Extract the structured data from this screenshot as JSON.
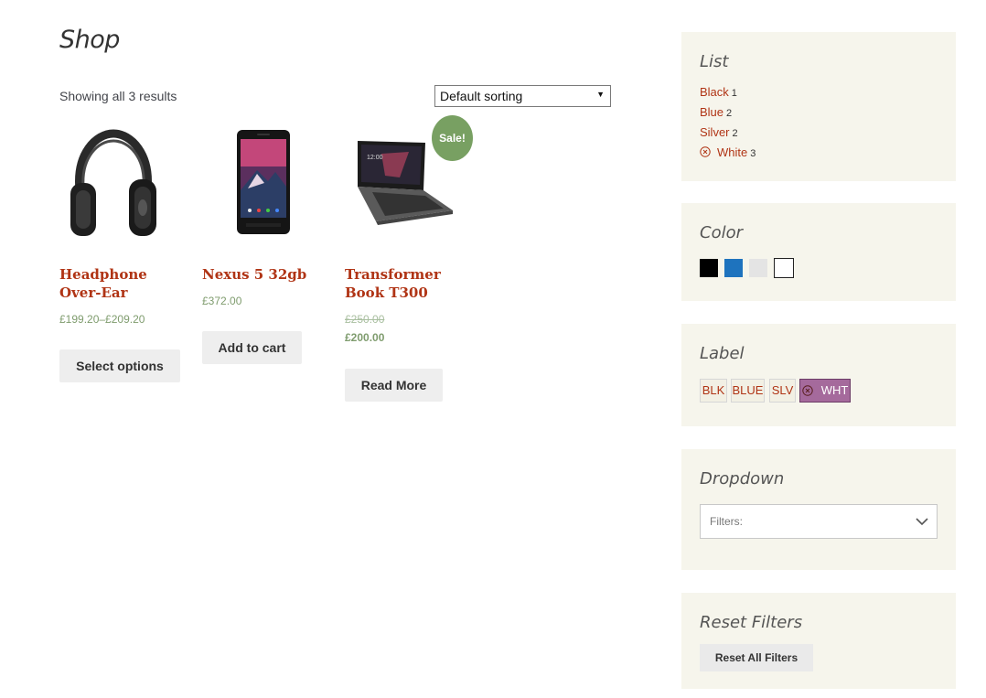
{
  "page": {
    "title": "Shop",
    "result_count": "Showing all 3 results",
    "sort_selected": "Default sorting"
  },
  "products": [
    {
      "title": "Headphone Over-Ear",
      "price": "£199.20–£209.20",
      "button": "Select options"
    },
    {
      "title": "Nexus 5 32gb",
      "price": "£372.00",
      "button": "Add to cart"
    },
    {
      "title": "Transformer Book T300",
      "price_old": "£250.00",
      "price_new": "£200.00",
      "button": "Read More",
      "badge": "Sale!"
    }
  ],
  "sidebar": {
    "list": {
      "title": "List",
      "items": [
        {
          "label": "Black",
          "count": "1"
        },
        {
          "label": "Blue",
          "count": "2"
        },
        {
          "label": "Silver",
          "count": "2"
        },
        {
          "label": "White",
          "count": "3",
          "active": true,
          "icon": "remove-circle-icon"
        }
      ]
    },
    "color": {
      "title": "Color",
      "swatches": [
        "#000000",
        "#1e73be",
        "#e4e4e4",
        "#ffffff"
      ]
    },
    "label": {
      "title": "Label",
      "chips": [
        {
          "label": "BLK"
        },
        {
          "label": "BLUE"
        },
        {
          "label": "SLV"
        },
        {
          "label": "WHT",
          "active": true
        }
      ]
    },
    "dropdown": {
      "title": "Dropdown",
      "placeholder": "Filters:"
    },
    "reset": {
      "title": "Reset Filters",
      "button": "Reset All Filters"
    }
  },
  "colors": {
    "link": "#b03415",
    "price": "#7f9c6e",
    "widget_bg": "#f6f5ec",
    "sale_badge": "#78a062",
    "active_chip": "#a56a9c"
  }
}
